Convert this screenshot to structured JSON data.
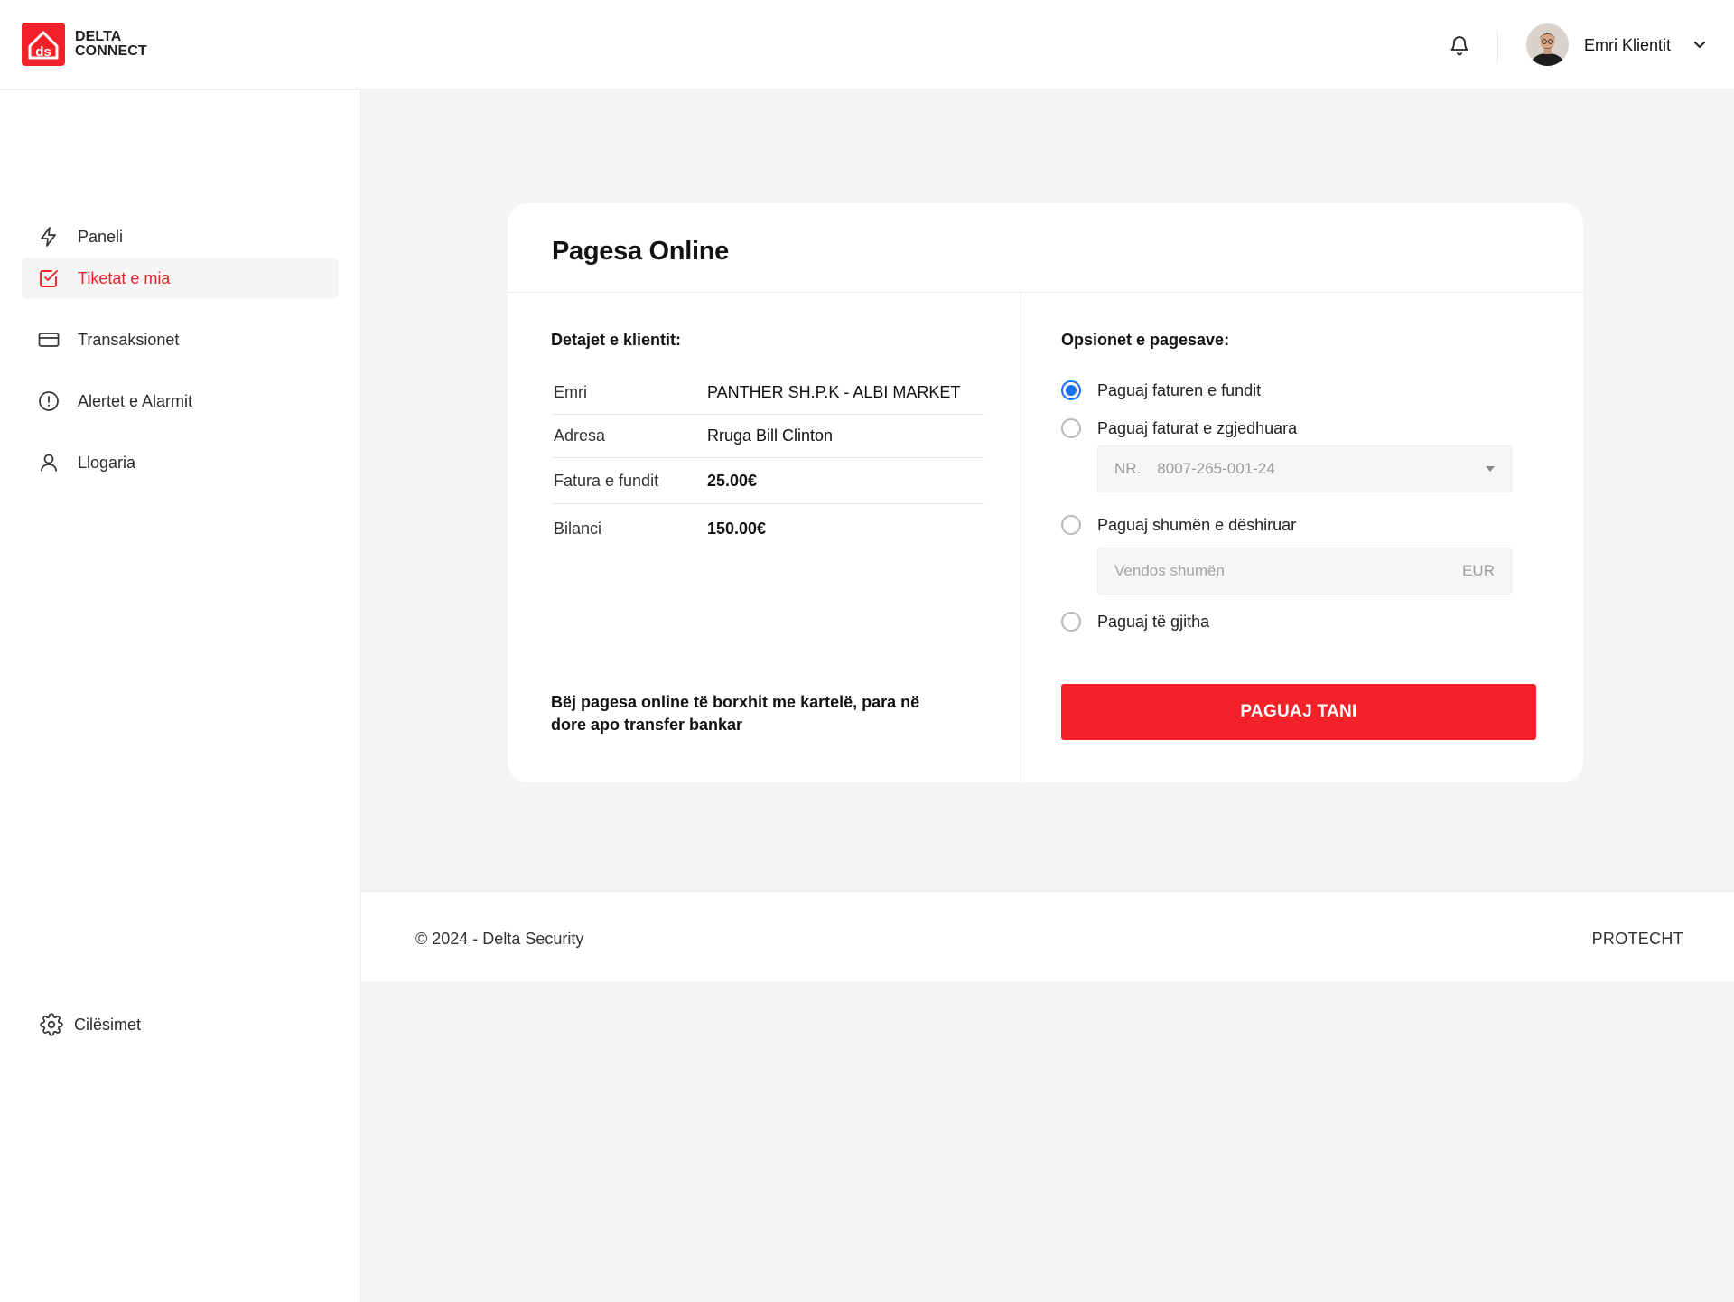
{
  "brand": {
    "line1": "DELTA",
    "line2": "CONNECT",
    "logo_letters": "ds",
    "accent": "#f3222a"
  },
  "header": {
    "user_name": "Emri Klientit",
    "icons": [
      "bell-icon",
      "chevron-down-icon"
    ]
  },
  "sidebar": {
    "items": [
      {
        "label": "Paneli",
        "icon": "lightning-icon",
        "active": false
      },
      {
        "label": "Tiketat e mia",
        "icon": "checkbox-icon",
        "active": true
      },
      {
        "label": "Transaksionet",
        "icon": "credit-card-icon",
        "active": false
      },
      {
        "label": "Alertet e Alarmit",
        "icon": "alert-circle-icon",
        "active": false
      },
      {
        "label": "Llogaria",
        "icon": "user-icon",
        "active": false
      }
    ],
    "settings_label": "Cilësimet"
  },
  "payment": {
    "title": "Pagesa Online",
    "client_heading": "Detajet e klientit:",
    "details": [
      {
        "key": "Emri",
        "value": "PANTHER SH.P.K - ALBI MARKET",
        "bold": false
      },
      {
        "key": "Adresa",
        "value": "Rruga Bill Clinton",
        "bold": false
      },
      {
        "key": "Fatura e fundit",
        "value": "25.00€",
        "bold": true
      },
      {
        "key": "Bilanci",
        "value": "150.00€",
        "bold": true
      }
    ],
    "note": "Bëj pagesa online të borxhit me kartelë, para në dore apo transfer bankar",
    "options_heading": "Opsionet e pagesave:",
    "options": [
      {
        "label": "Paguaj faturen e fundit",
        "selected": true
      },
      {
        "label": "Paguaj faturat e zgjedhuara",
        "selected": false
      },
      {
        "label": "Paguaj shumën e dëshiruar",
        "selected": false
      },
      {
        "label": "Paguaj të gjitha",
        "selected": false
      }
    ],
    "invoice_select": {
      "prefix": "NR.",
      "value": "8007-265-001-24"
    },
    "amount_input": {
      "placeholder": "Vendos shumën",
      "currency": "EUR"
    },
    "pay_button": "PAGUAJ TANI"
  },
  "footer": {
    "copyright": "© 2024 - Delta Security",
    "right": "PROTECHT"
  }
}
